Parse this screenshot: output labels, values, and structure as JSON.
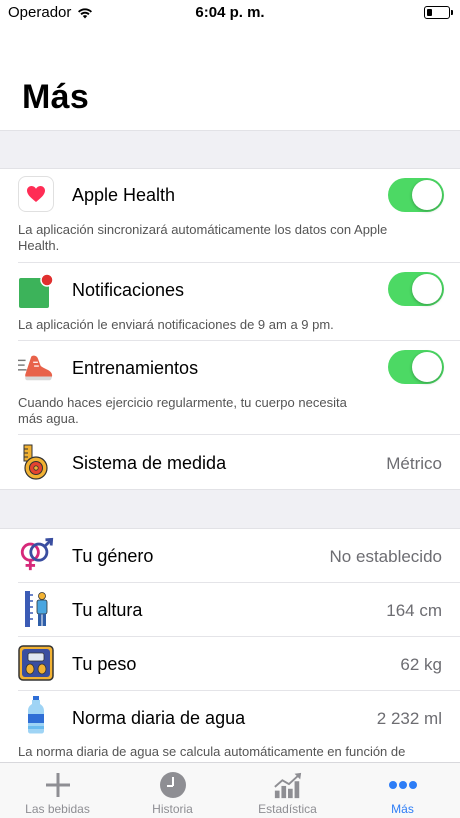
{
  "status": {
    "carrier": "Operador",
    "time": "6:04 p. m."
  },
  "page": {
    "title": "Más"
  },
  "settings": {
    "apple_health": {
      "label": "Apple Health",
      "description": "La aplicación sincronizará automáticamente los datos con Apple Health.",
      "enabled": true
    },
    "notifications": {
      "label": "Notificaciones",
      "description": "La aplicación le enviará notificaciones de 9 am a 9 pm.",
      "enabled": true
    },
    "workouts": {
      "label": "Entrenamientos",
      "description": "Cuando haces ejercicio regularmente, tu cuerpo necesita más agua.",
      "enabled": true
    },
    "units": {
      "label": "Sistema de medida",
      "value": "Métrico"
    }
  },
  "profile": {
    "gender": {
      "label": "Tu género",
      "value": "No establecido"
    },
    "height": {
      "label": "Tu altura",
      "value": "164 cm"
    },
    "weight": {
      "label": "Tu peso",
      "value": "62 kg"
    },
    "water": {
      "label": "Norma diaria de agua",
      "value": "2 232 ml",
      "description": "La norma diaria de agua se calcula automáticamente en función de"
    }
  },
  "tabs": [
    {
      "label": "Las bebidas",
      "icon": "plus-icon"
    },
    {
      "label": "Historia",
      "icon": "clock-icon"
    },
    {
      "label": "Estadística",
      "icon": "chart-icon"
    },
    {
      "label": "Más",
      "icon": "more-icon",
      "active": true
    }
  ],
  "colors": {
    "toggle_on": "#4cd964",
    "accent": "#2d7df6",
    "heart": "#ff2d55",
    "notification_square": "#3cb35a",
    "notification_dot": "#e0302f"
  }
}
